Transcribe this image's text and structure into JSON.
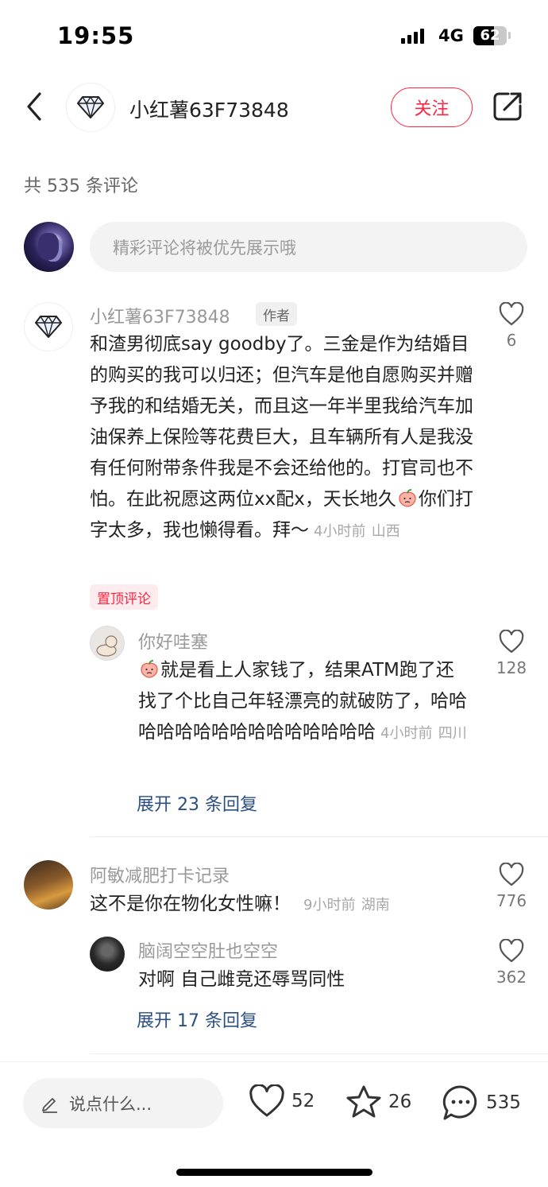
{
  "status_bar": {
    "time": "19:55",
    "network": "4G",
    "battery": "62",
    "battery_level": 0.62
  },
  "header": {
    "author_name": "小红薯63F73848",
    "follow_label": "关注"
  },
  "comments_header": {
    "count_text": "共 535 条评论"
  },
  "comment_input": {
    "placeholder": "精彩评论将被优先展示哦"
  },
  "comments": [
    {
      "name": "小红薯63F73848",
      "tag": "作者",
      "text_before_emoji": "和渣男彻底say goodby了。三金是作为结婚目的购买的我可以归还；但汽车是他自愿购买并赠予我的和结婚无关，而且这一年半里我给汽车加油保养上保险等花费巨大，且车辆所有人是我没有任何附带条件我是不会还给他的。打官司也不怕。在此祝愿这两位xx配x，天长地久",
      "text_after_emoji": "你们打字太多，我也懒得看。拜～",
      "time": "4小时前",
      "location": "山西",
      "likes": "6",
      "pinned_label": "置顶评论",
      "reply": {
        "name": "你好哇塞",
        "text": "就是看上人家钱了，结果ATM跑了还找了个比自己年轻漂亮的就破防了，哈哈哈哈哈哈哈哈哈哈哈哈哈哈哈",
        "time": "4小时前",
        "location": "四川",
        "likes": "128"
      },
      "expand_label": "展开 23 条回复"
    },
    {
      "name": "阿敏减肥打卡记录",
      "text": "这不是你在物化女性嘛！",
      "time": "9小时前",
      "location": "湖南",
      "likes": "776",
      "reply": {
        "name": "脑阔空空肚也空空",
        "text": "对啊 自己雌竞还辱骂同性",
        "likes": "362"
      },
      "expand_label": "展开 17 条回复"
    }
  ],
  "bottom_bar": {
    "input_placeholder": "说点什么...",
    "likes": "52",
    "favorites": "26",
    "comments": "535"
  },
  "colors": {
    "accent": "#ff2442",
    "link": "#2b4f85",
    "muted": "#999999"
  },
  "icons": [
    "back-icon",
    "diamond-icon",
    "share-icon",
    "heart-icon",
    "star-icon",
    "chat-icon",
    "pencil-icon",
    "peach-emoji-icon"
  ]
}
